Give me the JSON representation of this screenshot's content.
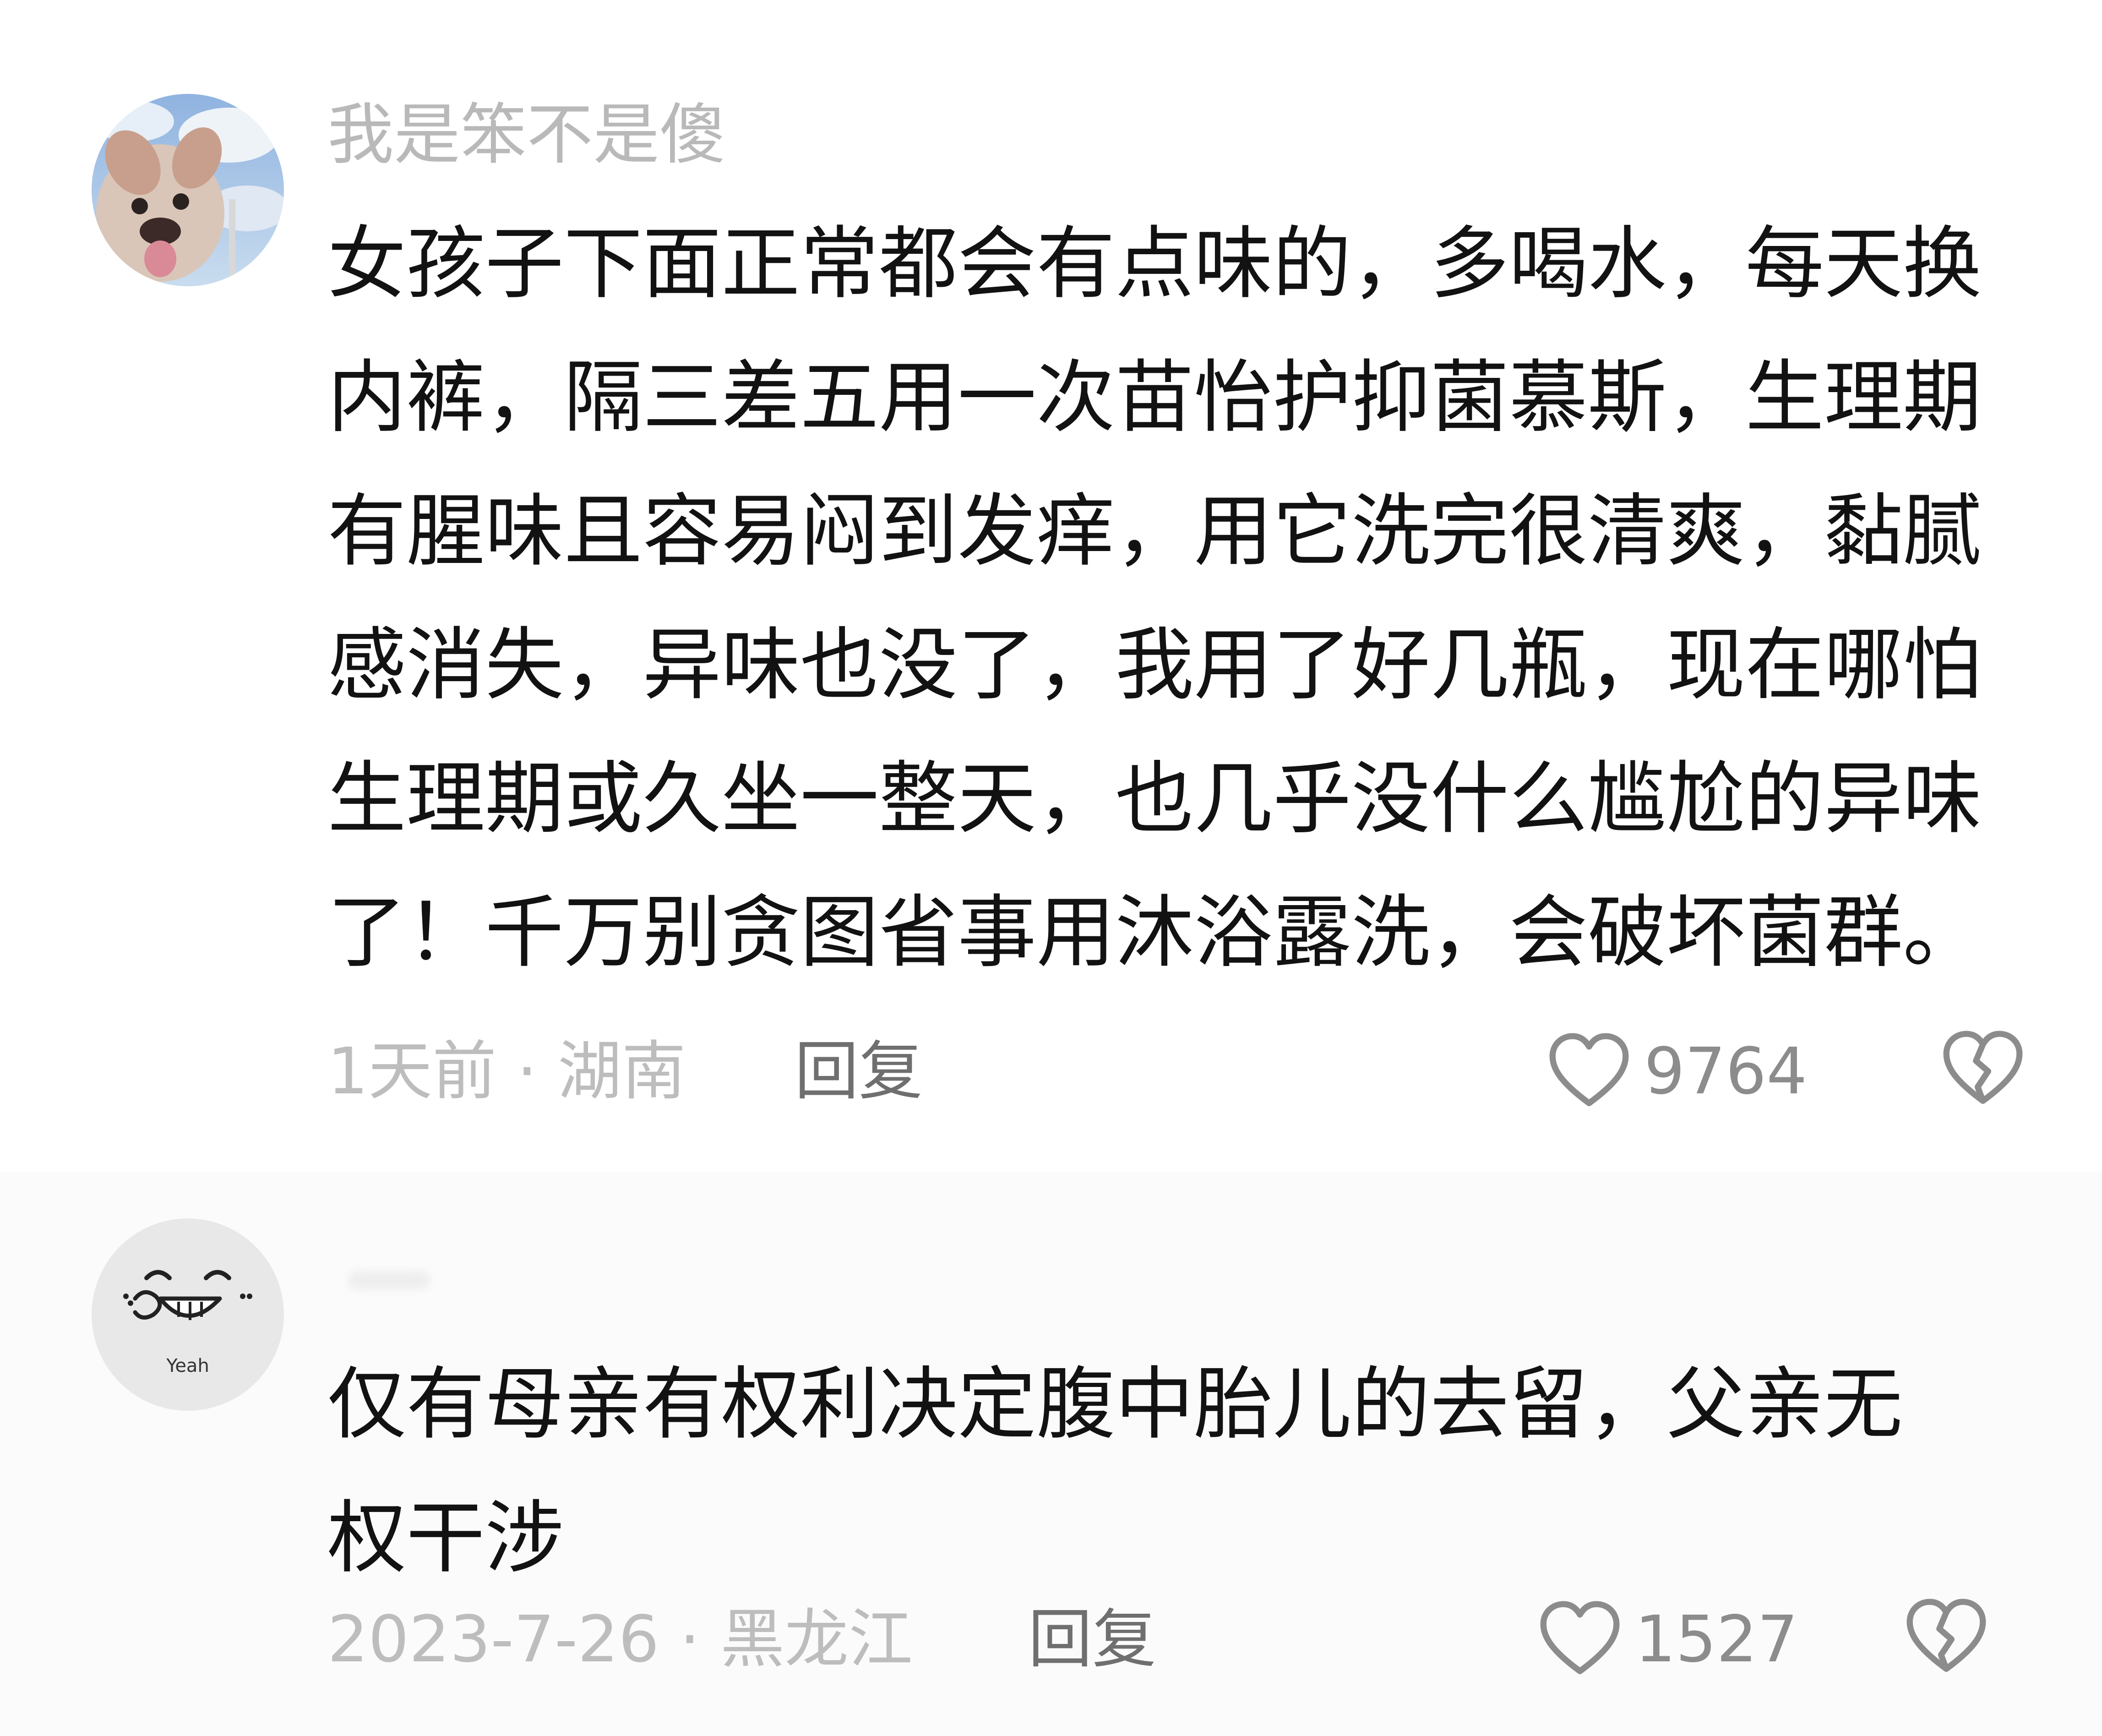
{
  "comments": [
    {
      "username": "我是笨不是傻",
      "text": "女孩子下面正常都会有点味的，多喝水，每天换内裤，隔三差五用一次苗怡护抑菌慕斯，生理期有腥味且容易闷到发痒，用它洗完很清爽，黏腻感消失，异味也没了，我用了好几瓶，现在哪怕生理期或久坐一整天，也几乎没什么尴尬的异味了！千万别贪图省事用沐浴露洗，会破坏菌群。",
      "meta": "1天前 · 湖南",
      "reply_label": "回复",
      "likes": "9764",
      "avatar_icon": "dog-avatar-icon"
    },
    {
      "username": "",
      "text": "仅有母亲有权利决定腹中胎儿的去留，父亲无权干涉",
      "meta": "2023-7-26 · 黑龙江",
      "reply_label": "回复",
      "likes": "1527",
      "avatar_icon": "smiley-yeah-avatar-icon",
      "avatar_caption": "Yeah"
    }
  ],
  "colors": {
    "username": "#b9b9b9",
    "meta": "#bdbdbd",
    "reply": "#6f6f6f",
    "icon": "#8c8c8c"
  }
}
